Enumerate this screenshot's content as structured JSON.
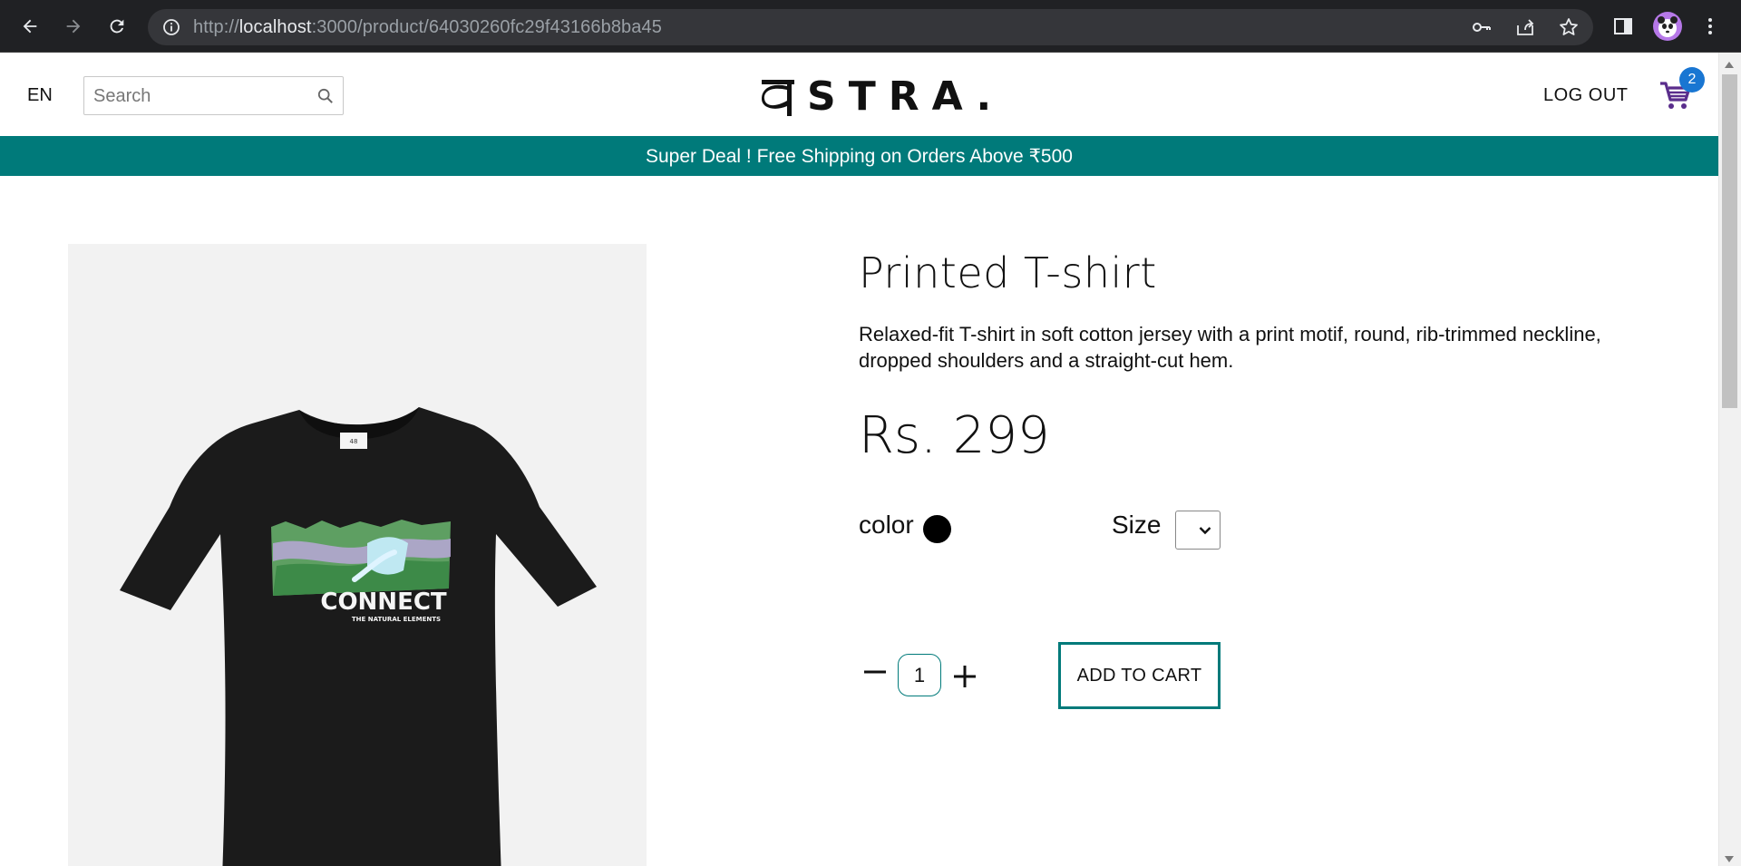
{
  "browser": {
    "url_prefix": "http://",
    "url_host": "localhost",
    "url_rest": ":3000/product/64030260fc29f43166b8ba45"
  },
  "header": {
    "language": "EN",
    "search_placeholder": "Search",
    "logo_text": "STRA.",
    "logout_label": "LOG OUT",
    "cart_count": "2"
  },
  "promo": {
    "text": "Super Deal ! Free Shipping on Orders Above ₹500"
  },
  "product": {
    "title": "Printed T-shirt",
    "description": "Relaxed-fit T-shirt in soft cotton jersey with a print motif, round, rib-trimmed neckline, dropped shoulders and a straight-cut hem.",
    "price": "Rs. 299",
    "color_label": "color",
    "color_value": "#000000",
    "size_label": "Size",
    "quantity": "1",
    "add_to_cart_label": "ADD TO CART",
    "print_main": "CONNECT",
    "print_sub": "THE NATURAL ELEMENTS",
    "neck_tag": "48"
  },
  "colors": {
    "accent": "#007a7a",
    "badge": "#1976d2"
  }
}
